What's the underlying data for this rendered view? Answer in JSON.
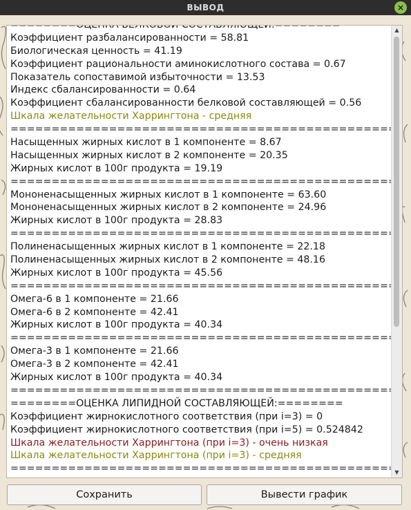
{
  "window": {
    "title": "ВЫВОД",
    "close_symbol": "×"
  },
  "output_lines": [
    {
      "text": "========ОЦЕНКА БЕЛКОВОЙ СОСТАВЛЯЮЩЕЙ:========",
      "color": "#1a1a1a"
    },
    {
      "text": "Коэффициент разбалансированности = 58.81",
      "color": "#1a1a1a"
    },
    {
      "text": "Биологическая ценность = 41.19",
      "color": "#1a1a1a"
    },
    {
      "text": "Коэффициент рациональности аминокислотного состава = 0.67",
      "color": "#1a1a1a"
    },
    {
      "text": "Показатель сопоставимой избыточности = 13.53",
      "color": "#1a1a1a"
    },
    {
      "text": "Индекс сбалансированности = 0.64",
      "color": "#1a1a1a"
    },
    {
      "text": "Коэффициент сбалансированности белковой составляющей = 0.56",
      "color": "#1a1a1a"
    },
    {
      "text": "Шкала желательности Харрингтона - средняя",
      "color": "#8a8a10"
    },
    {
      "text": "=================================================",
      "color": "#1a1a1a"
    },
    {
      "text": "Насыщенных жирных кислот в 1 компоненте = 8.67",
      "color": "#1a1a1a"
    },
    {
      "text": "Насыщенных жирных кислот в 2 компоненте = 20.35",
      "color": "#1a1a1a"
    },
    {
      "text": "Жирных кислот в 100г продукта = 19.19",
      "color": "#1a1a1a"
    },
    {
      "text": "=================================================",
      "color": "#1a1a1a"
    },
    {
      "text": "Мононенасыщенных жирных кислот в 1 компоненте = 63.60",
      "color": "#1a1a1a"
    },
    {
      "text": "Мононенасыщенных жирных кислот в 2 компоненте = 24.96",
      "color": "#1a1a1a"
    },
    {
      "text": "Жирных кислот в 100г продукта = 28.83",
      "color": "#1a1a1a"
    },
    {
      "text": "=================================================",
      "color": "#1a1a1a"
    },
    {
      "text": "Полиненасыщенных жирных кислот в 1 компоненте = 22.18",
      "color": "#1a1a1a"
    },
    {
      "text": "Полиненасыщенных жирных кислот в 2 компоненте = 48.16",
      "color": "#1a1a1a"
    },
    {
      "text": "Жирных кислот в 100г продукта = 45.56",
      "color": "#1a1a1a"
    },
    {
      "text": "=================================================",
      "color": "#1a1a1a"
    },
    {
      "text": "Омега-6 в 1 компоненте = 21.66",
      "color": "#1a1a1a"
    },
    {
      "text": "Омега-6 в 2 компоненте = 42.41",
      "color": "#1a1a1a"
    },
    {
      "text": "Жирных кислот в 100г продукта = 40.34",
      "color": "#1a1a1a"
    },
    {
      "text": "=================================================",
      "color": "#1a1a1a"
    },
    {
      "text": "Омега-3 в 1 компоненте = 21.66",
      "color": "#1a1a1a"
    },
    {
      "text": "Омега-3 в 2 компоненте = 42.41",
      "color": "#1a1a1a"
    },
    {
      "text": "Жирных кислот в 100г продукта = 40.34",
      "color": "#1a1a1a"
    },
    {
      "text": "=================================================",
      "color": "#1a1a1a"
    },
    {
      "text": "========ОЦЕНКА ЛИПИДНОЙ СОСТАВЛЯЮЩЕЙ:========",
      "color": "#1a1a1a"
    },
    {
      "text": "Коэффициент жирнокислотного соответствия (при i=3) = 0",
      "color": "#1a1a1a"
    },
    {
      "text": "Коэффициент жирнокислотного соответствия (при i=5) = 0.524842",
      "color": "#1a1a1a"
    },
    {
      "text": "Шкала желательности Харрингтона (при i=3) - очень низкая",
      "color": "#8b1a1a"
    },
    {
      "text": "Шкала желательности Харрингтона (при i=3) - средняя",
      "color": "#8a8a10"
    },
    {
      "text": "=================================================",
      "color": "#1a1a1a"
    }
  ],
  "scrollbar": {
    "up_symbol": "▲",
    "down_symbol": "▼"
  },
  "buttons": {
    "save_label": "Сохранить",
    "plot_label": "Вывести график"
  }
}
